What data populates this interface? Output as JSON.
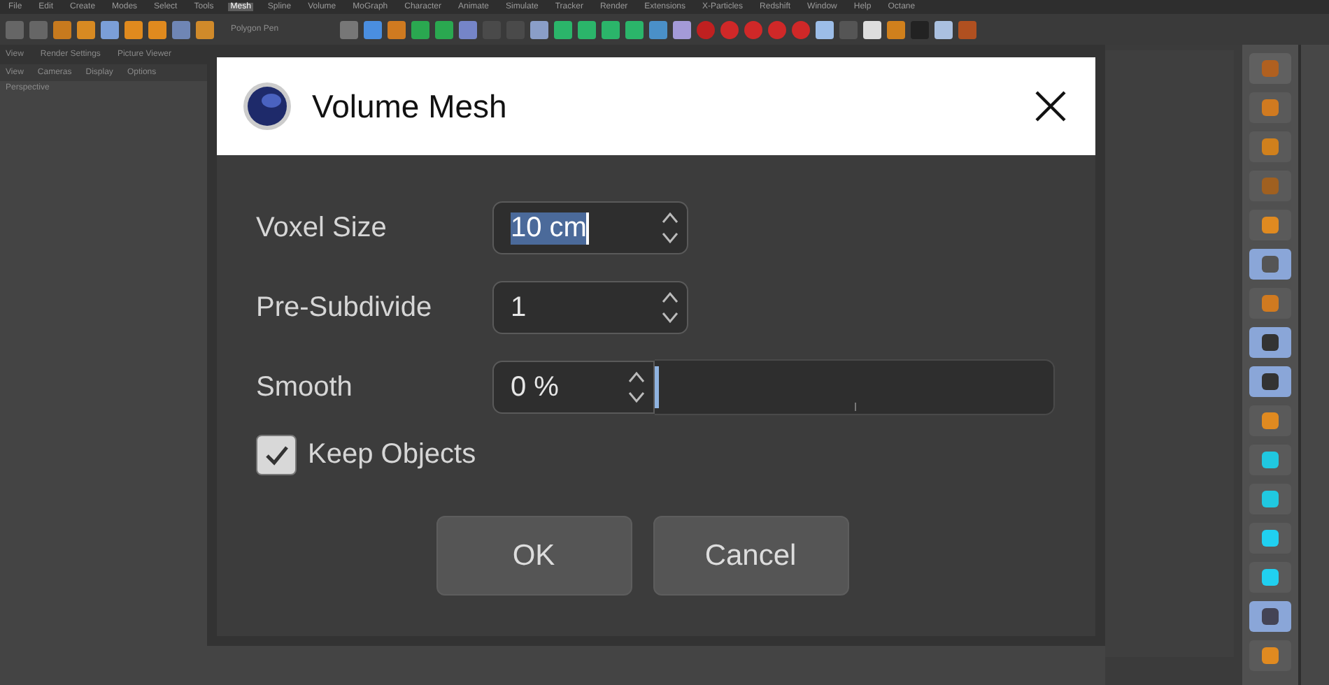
{
  "app": {
    "menu": [
      {
        "label": "File",
        "selected": false
      },
      {
        "label": "Edit",
        "selected": false
      },
      {
        "label": "Create",
        "selected": false
      },
      {
        "label": "Modes",
        "selected": false
      },
      {
        "label": "Select",
        "selected": false
      },
      {
        "label": "Tools",
        "selected": false
      },
      {
        "label": "Mesh",
        "selected": true
      },
      {
        "label": "Spline",
        "selected": false
      },
      {
        "label": "Volume",
        "selected": false
      },
      {
        "label": "MoGraph",
        "selected": false
      },
      {
        "label": "Character",
        "selected": false
      },
      {
        "label": "Animate",
        "selected": false
      },
      {
        "label": "Simulate",
        "selected": false
      },
      {
        "label": "Tracker",
        "selected": false
      },
      {
        "label": "Render",
        "selected": false
      },
      {
        "label": "Extensions",
        "selected": false
      },
      {
        "label": "X-Particles",
        "selected": false
      },
      {
        "label": "Redshift",
        "selected": false
      },
      {
        "label": "Window",
        "selected": false
      },
      {
        "label": "Help",
        "selected": false
      },
      {
        "label": "Octane",
        "selected": false
      }
    ],
    "tool_label": "Polygon Pen",
    "viewport_tabs": [
      "View",
      "Render Settings",
      "Picture Viewer"
    ],
    "viewport_menu": [
      "View",
      "Cameras",
      "Display",
      "Options"
    ],
    "viewport_label": "Perspective"
  },
  "dialog": {
    "title": "Volume Mesh",
    "fields": [
      {
        "kind": "spinner",
        "label": "Voxel Size",
        "value": "10 cm",
        "focused": true
      },
      {
        "kind": "spinner",
        "label": "Pre-Subdivide",
        "value": "1",
        "focused": false
      },
      {
        "kind": "slider",
        "label": "Smooth",
        "value": "0 %",
        "level": 0
      }
    ],
    "checkbox": {
      "label": "Keep Objects",
      "checked": true
    },
    "buttons": [
      "OK",
      "Cancel"
    ]
  }
}
